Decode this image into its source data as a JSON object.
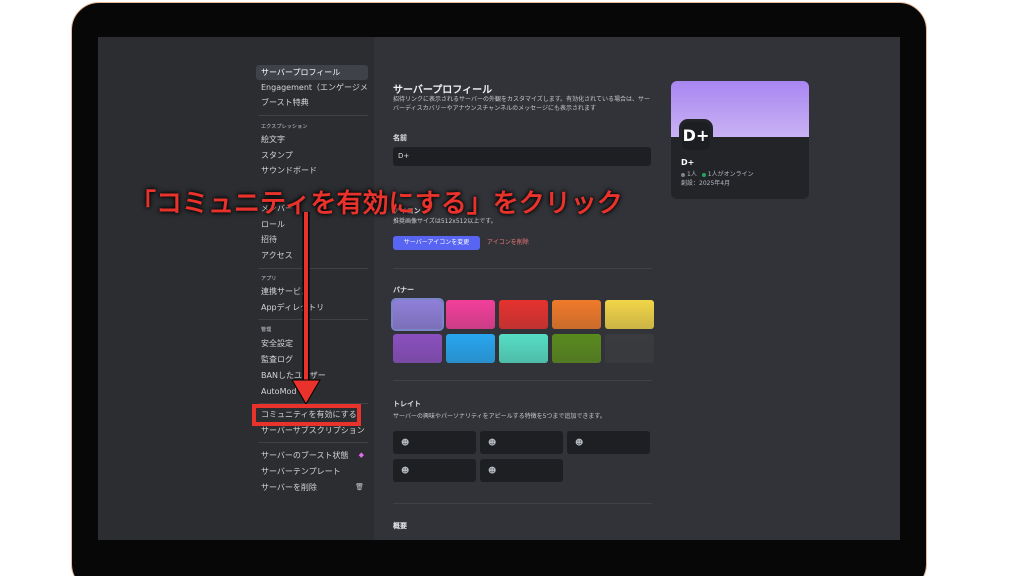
{
  "sidebar": {
    "items": [
      {
        "label": "サーバープロフィール",
        "active": true
      },
      {
        "label": "Engagement（エンゲージメ…"
      },
      {
        "label": "ブースト特典"
      },
      {
        "header": "エクスプレッション"
      },
      {
        "label": "絵文字"
      },
      {
        "label": "スタンプ"
      },
      {
        "label": "サウンドボード"
      },
      {
        "label": "メンバー"
      },
      {
        "label": "ロール"
      },
      {
        "label": "招待"
      },
      {
        "label": "アクセス"
      },
      {
        "header": "アプリ"
      },
      {
        "label": "連携サービス"
      },
      {
        "label": "Appディレクトリ"
      },
      {
        "header": "管理"
      },
      {
        "label": "安全設定"
      },
      {
        "label": "監査ログ"
      },
      {
        "label": "BANしたユーザー"
      },
      {
        "label": "AutoMod"
      },
      {
        "label": "コミュニティを有効にする"
      },
      {
        "label": "サーバーサブスクリプション"
      },
      {
        "label": "サーバーのブースト状態"
      },
      {
        "label": "サーバーテンプレート"
      },
      {
        "label": "サーバーを削除"
      }
    ]
  },
  "main": {
    "title": "サーバープロフィール",
    "description": "招待リンクに表示されるサーバーの外観をカスタマイズします。有効化されている場合は、サーバーディスカバリーやアナウンスチャンネルのメッセージにも表示されます",
    "name_label": "名前",
    "name_value": "D+",
    "icon_label": "アイコン",
    "icon_hint": "推奨画像サイズは512x512以上です。",
    "change_icon_button": "サーバーアイコンを変更",
    "remove_icon_link": "アイコンを削除",
    "banner_label": "バナー",
    "banner_colors": [
      "#8f7fd9",
      "#f23f9a",
      "#e5322f",
      "#f07a2a",
      "#f1d548",
      "#8b4fbf",
      "#27a6f0",
      "#56dec4",
      "#5a8a1e",
      "#3a3b3f"
    ],
    "traits_label": "トレイト",
    "traits_description": "サーバーの興味やパーソナリティをアピールする特徴を5つまで追加できます。",
    "trait_icon": "☻",
    "summary_label": "概要"
  },
  "card": {
    "avatar_text": "D+",
    "name": "D+",
    "members": "1人",
    "online": "1人がオンライン",
    "created": "創設：2025年4月"
  },
  "annotation": {
    "text": "「コミュニティを有効にする」をクリック",
    "color": "#e8322b"
  }
}
